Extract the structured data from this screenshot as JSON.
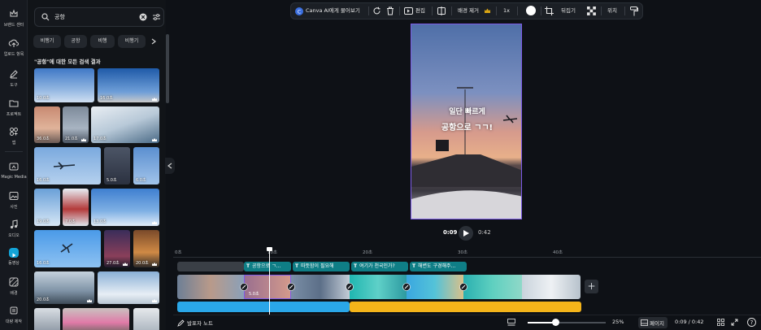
{
  "rail": {
    "items": [
      {
        "label": "브랜드 센터",
        "icon": "crown-icon"
      },
      {
        "label": "업로드 항목",
        "icon": "cloud-upload-icon"
      },
      {
        "label": "도구",
        "icon": "pen-tool-icon"
      },
      {
        "label": "프로젝트",
        "icon": "folder-icon"
      },
      {
        "label": "앱",
        "icon": "apps-icon"
      },
      {
        "label": "Magic Media",
        "icon": "magic-media-icon"
      },
      {
        "label": "사진",
        "icon": "photo-icon"
      },
      {
        "label": "오디오",
        "icon": "music-icon"
      },
      {
        "label": "동영상",
        "icon": "video-icon"
      },
      {
        "label": "배경",
        "icon": "background-icon"
      },
      {
        "label": "대량 제작",
        "icon": "bulk-create-icon"
      }
    ],
    "active_index": 8,
    "accent_color": "#13a4d8"
  },
  "search": {
    "value": "공항"
  },
  "chips": [
    "비행기",
    "공항",
    "비행",
    "비행기"
  ],
  "results_title": "\"공항\"에 대한 모든 검색 결과",
  "thumbnails": [
    {
      "duration": "10.0초",
      "premium": false
    },
    {
      "duration": "16.0초",
      "premium": true
    },
    {
      "duration": "36.0초",
      "premium": false
    },
    {
      "duration": "21.0초",
      "premium": true
    },
    {
      "duration": "17.0초",
      "premium": true
    },
    {
      "duration": "16.0초",
      "premium": false
    },
    {
      "duration": "5.0초",
      "premium": false
    },
    {
      "duration": "6.0초",
      "premium": false
    },
    {
      "duration": "19.0초",
      "premium": false
    },
    {
      "duration": "7.0초",
      "premium": false
    },
    {
      "duration": "13.0초",
      "premium": true
    },
    {
      "duration": "16.0초",
      "premium": false
    },
    {
      "duration": "27.0초",
      "premium": true
    },
    {
      "duration": "20.0초",
      "premium": true
    },
    {
      "duration": "20.0초",
      "premium": true
    },
    {
      "duration": "",
      "premium": true
    }
  ],
  "toolbar": {
    "ask_canva": "Canva AI에게 물어보기",
    "edit": "편집",
    "remove_bg": "배경 제거",
    "speed": "1x",
    "flip": "뒤집기",
    "position": "위치"
  },
  "preview": {
    "overlay_line1": "일단 빠르게",
    "overlay_line2": "공항으로 ㄱㄱ!",
    "frame_color": "#7d5be8"
  },
  "playback": {
    "current": "0:09",
    "total": "0:42"
  },
  "timeline": {
    "ruler": [
      "0초",
      "10초",
      "20초",
      "30초",
      "40초"
    ],
    "text_clips": [
      "공항으로 ㄱ...",
      "따뜻함이 필요해",
      "여기가 천국인가?",
      "해변도 구경해주..."
    ],
    "selected_clip_label": "5.0초",
    "add_label": "+"
  },
  "bottombar": {
    "notes": "발표자 노트",
    "zoom": "25%",
    "zoom_fraction": 0.36,
    "page": "페이지",
    "time": "0:09 / 0:42"
  }
}
